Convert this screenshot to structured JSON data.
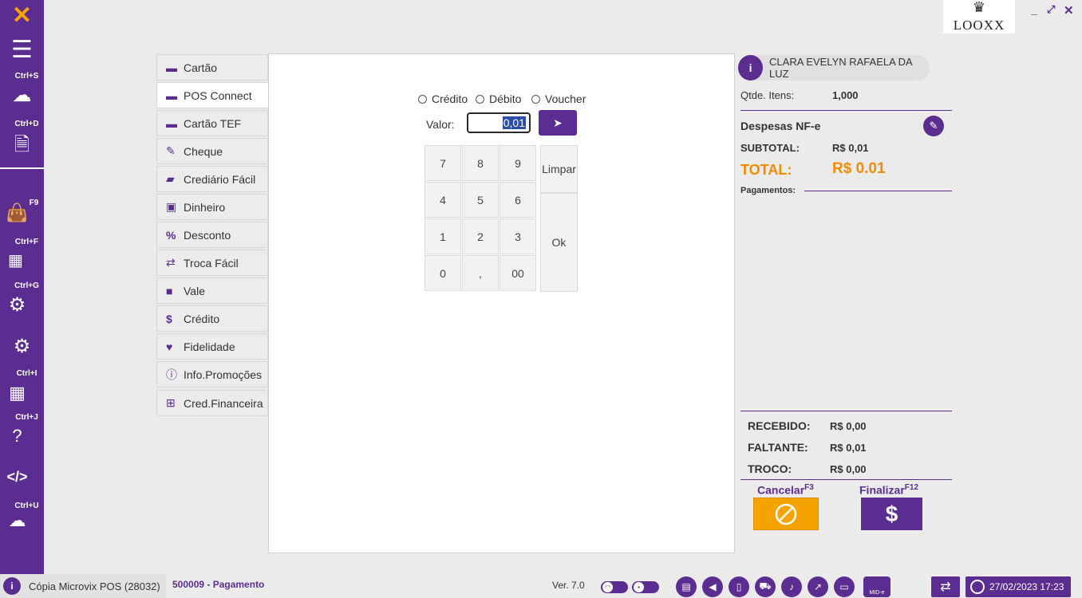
{
  "colors": {
    "accent": "#5c2d91",
    "total_orange": "#f08c00",
    "cancel_orange": "#f5a300"
  },
  "sidebar": {
    "shortcuts": [
      "Ctrl+S",
      "Ctrl+D",
      "F9",
      "Ctrl+F",
      "Ctrl+G",
      "Ctrl+I",
      "Ctrl+J",
      "Ctrl+U"
    ],
    "icons": [
      "logo-icon",
      "menu-icon",
      "cloud-icon",
      "document-icon",
      "shopping-bag-icon",
      "qr-code-icon",
      "gears-icon",
      "settings-icon",
      "grid-icon",
      "help-icon",
      "code-icon",
      "download-cloud-icon"
    ]
  },
  "logo": {
    "text": "LOOXX"
  },
  "methods": [
    {
      "label": "Cartão",
      "icon": "card-icon"
    },
    {
      "label": "POS Connect",
      "icon": "card-icon"
    },
    {
      "label": "Cartão TEF",
      "icon": "card-icon"
    },
    {
      "label": "Cheque",
      "icon": "edit-icon"
    },
    {
      "label": "Crediário Fácil",
      "icon": "book-icon"
    },
    {
      "label": "Dinheiro",
      "icon": "money-icon"
    },
    {
      "label": "Desconto",
      "icon": "percent-icon"
    },
    {
      "label": "Troca Fácil",
      "icon": "exchange-icon"
    },
    {
      "label": "Vale",
      "icon": "gift-icon"
    },
    {
      "label": "Crédito",
      "icon": "dollar-icon"
    },
    {
      "label": "Fidelidade",
      "icon": "heart-icon"
    },
    {
      "label": "Info.Promoções",
      "icon": "info-icon"
    },
    {
      "label": "Cred.Financeira",
      "icon": "plus-icon"
    }
  ],
  "payment": {
    "options": [
      "Crédito",
      "Débito",
      "Voucher"
    ],
    "valor_label": "Valor:",
    "valor_value": "0,01",
    "keys": [
      "7",
      "8",
      "9",
      "4",
      "5",
      "6",
      "1",
      "2",
      "3",
      "0",
      ",",
      "00"
    ],
    "clear_label": "Limpar",
    "ok_label": "Ok"
  },
  "summary": {
    "customer": "CLARA EVELYN RAFAELA DA LUZ",
    "qtd_label": "Qtde. Itens:",
    "qtd_value": "1,000",
    "despesas": "Despesas NF-e",
    "subtotal_label": "SUBTOTAL:",
    "subtotal_value": "R$ 0,01",
    "total_label": "TOTAL:",
    "total_value": "R$ 0.01",
    "pagamentos_label": "Pagamentos:",
    "recebido_label": "RECEBIDO:",
    "recebido_value": "R$ 0,00",
    "faltante_label": "FALTANTE:",
    "faltante_value": "R$ 0,01",
    "troco_label": "TROCO:",
    "troco_value": "R$ 0,00",
    "cancel_label": "Cancelar",
    "cancel_key": "F3",
    "finalize_label": "Finalizar",
    "finalize_key": "F12"
  },
  "footer": {
    "app": "Cópia Microvix POS (28032)",
    "screen": "500009 - Pagamento",
    "version": "Ver. 7.0",
    "datetime": "27/02/2023 17:23",
    "mid_label": "MID-e"
  }
}
